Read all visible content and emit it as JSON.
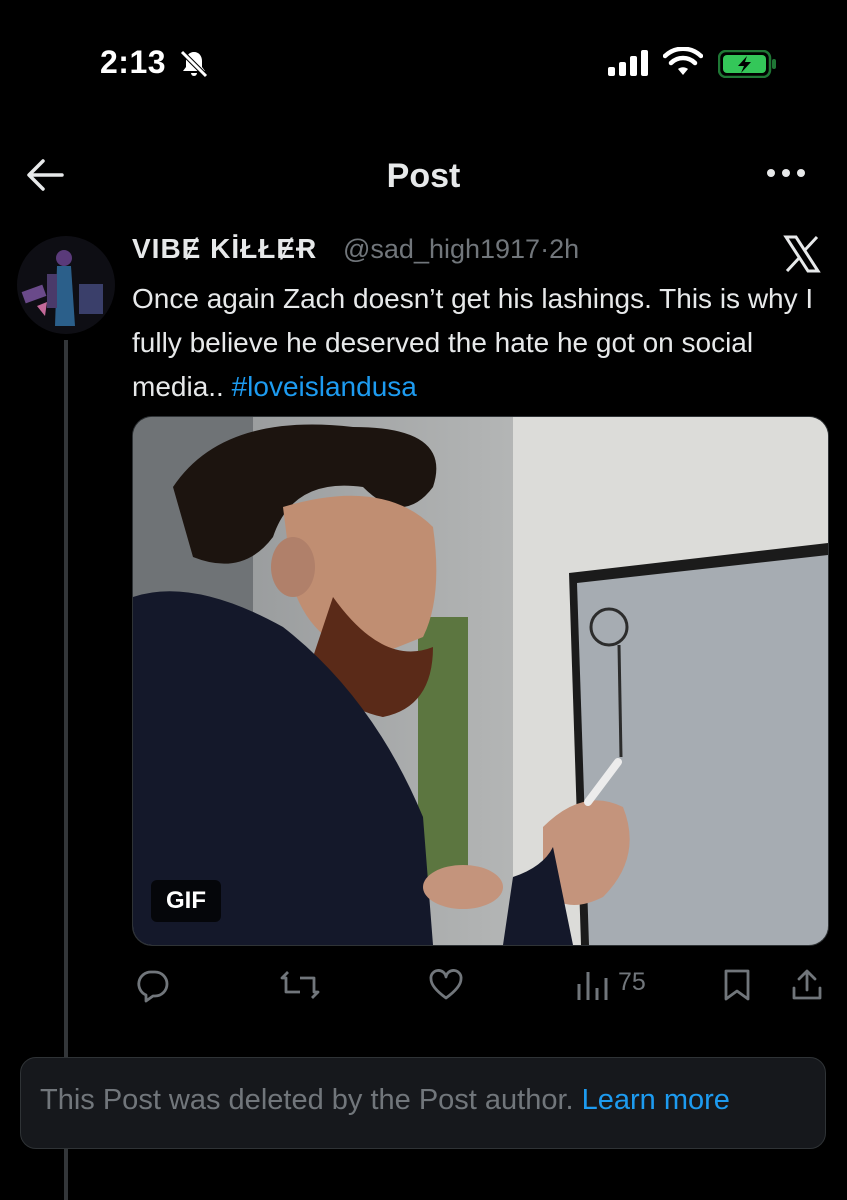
{
  "status_bar": {
    "time": "2:13",
    "icons": [
      "bell-slash-icon",
      "signal-icon",
      "wifi-icon",
      "battery-charging-icon"
    ],
    "battery_color": "#34c759"
  },
  "header": {
    "title": "Post",
    "back_icon": "arrow-left-icon",
    "more_icon": "more-horizontal-icon"
  },
  "tweet": {
    "display_name": "VIBɆ KİŁŁɆɌ",
    "handle": "@sad_high1917",
    "separator": "·",
    "time_ago": "2h",
    "text": "Once again Zach doesn’t get his lashings. This is why I fully believe he deserved the hate he got on social media.. ",
    "hashtag": "#loveislandusa",
    "media": {
      "type": "gif",
      "badge": "GIF"
    },
    "actions": {
      "reply_icon": "reply-icon",
      "retweet_icon": "retweet-icon",
      "like_icon": "heart-icon",
      "views_icon": "views-icon",
      "views_count": "75",
      "bookmark_icon": "bookmark-icon",
      "share_icon": "share-icon"
    }
  },
  "deleted_notice": {
    "text": "This Post was deleted by the Post author. ",
    "link": "Learn more"
  },
  "colors": {
    "background": "#000000",
    "text": "#e7e9ea",
    "muted": "#71767b",
    "accent": "#1d9bf0"
  }
}
